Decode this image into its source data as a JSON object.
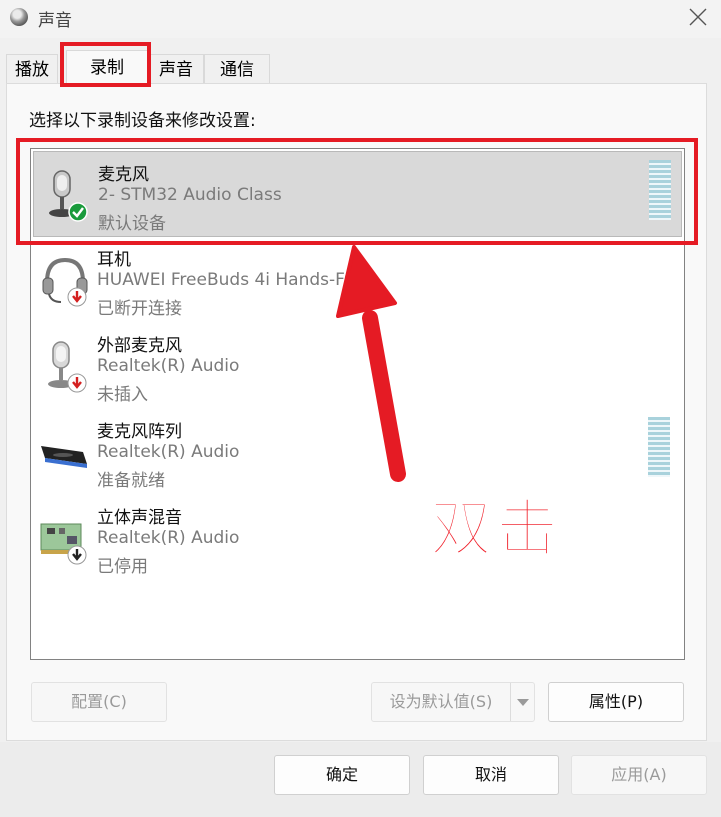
{
  "window": {
    "title": "声音"
  },
  "tabs": [
    {
      "label": "播放"
    },
    {
      "label": "录制"
    },
    {
      "label": "声音"
    },
    {
      "label": "通信"
    }
  ],
  "panel": {
    "instruction": "选择以下录制设备来修改设置:",
    "devices": [
      {
        "name": "麦克风",
        "description": "2- STM32 Audio Class",
        "status": "默认设备",
        "icon": "microphone-icon",
        "badge": "default-check-icon",
        "selected": true,
        "level_meter": true
      },
      {
        "name": "耳机",
        "description": "HUAWEI FreeBuds 4i Hands-Free",
        "status": "已断开连接",
        "icon": "headset-icon",
        "badge": "disconnected-arrow-icon",
        "selected": false,
        "level_meter": false
      },
      {
        "name": "外部麦克风",
        "description": "Realtek(R) Audio",
        "status": "未插入",
        "icon": "microphone-icon",
        "badge": "disconnected-arrow-icon",
        "selected": false,
        "level_meter": false
      },
      {
        "name": "麦克风阵列",
        "description": "Realtek(R) Audio",
        "status": "准备就绪",
        "icon": "microphone-array-icon",
        "badge": "",
        "selected": false,
        "level_meter": true
      },
      {
        "name": "立体声混音",
        "description": "Realtek(R) Audio",
        "status": "已停用",
        "icon": "sound-card-icon",
        "badge": "disabled-arrow-icon",
        "selected": false,
        "level_meter": false
      }
    ],
    "buttons": {
      "configure": "配置(C)",
      "set_default": "设为默认值(S)",
      "properties": "属性(P)"
    }
  },
  "footer": {
    "ok": "确定",
    "cancel": "取消",
    "apply": "应用(A)"
  },
  "annotation": {
    "text": "双击",
    "color": "#e51b24"
  }
}
